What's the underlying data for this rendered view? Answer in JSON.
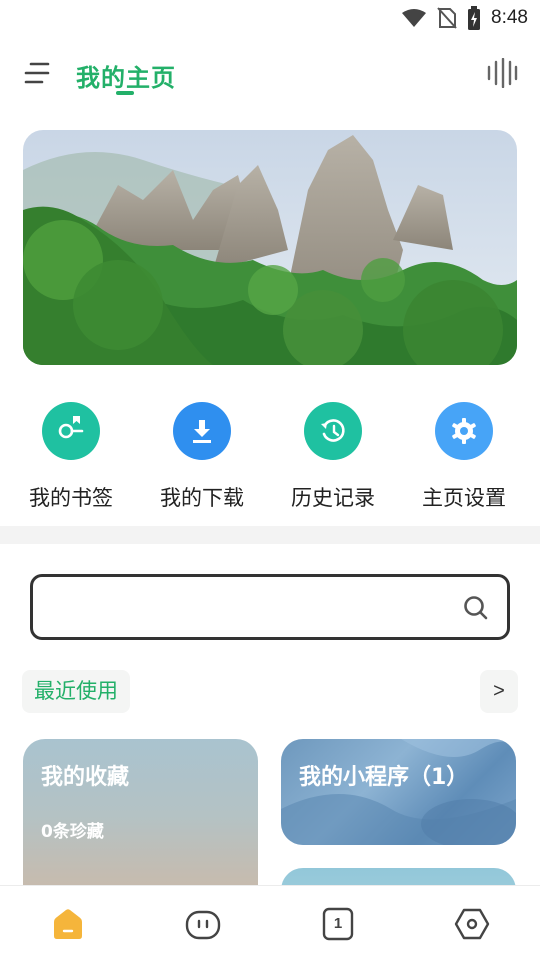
{
  "status_bar": {
    "time": "8:48"
  },
  "header": {
    "title": "我的主页"
  },
  "quick_actions": [
    {
      "label": "我的书签",
      "icon": "bookmark-icon",
      "color": "#1fc1a1"
    },
    {
      "label": "我的下载",
      "icon": "download-icon",
      "color": "#2f8fef"
    },
    {
      "label": "历史记录",
      "icon": "history-icon",
      "color": "#1fc1a1"
    },
    {
      "label": "主页设置",
      "icon": "gear-icon",
      "color": "#47a4f7"
    }
  ],
  "search": {
    "value": "",
    "placeholder": ""
  },
  "recent": {
    "label": "最近使用",
    "more_label": ">"
  },
  "cards": {
    "favorites": {
      "title": "我的收藏",
      "subtitle": "0条珍藏"
    },
    "mini_programs": {
      "title": "我的小程序（1）"
    }
  },
  "bottom_nav": [
    {
      "icon": "home-icon",
      "active": true
    },
    {
      "icon": "face-icon",
      "active": false
    },
    {
      "icon": "tab-count-icon",
      "count": "1",
      "active": false
    },
    {
      "icon": "hexagon-icon",
      "active": false
    }
  ],
  "colors": {
    "accent": "#23b069",
    "active_nav": "#f5b53b"
  }
}
